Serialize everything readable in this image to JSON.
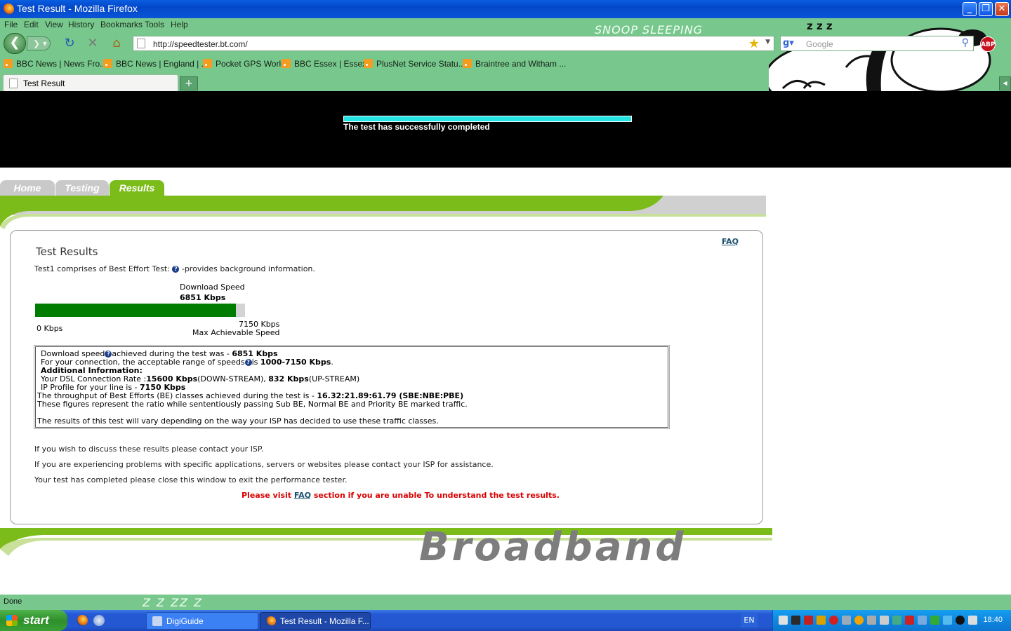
{
  "window": {
    "title": "Test Result - Mozilla Firefox",
    "minimize": "_",
    "restore": "❐",
    "close": "✕"
  },
  "menu": {
    "file": "File",
    "edit": "Edit",
    "view": "View",
    "history": "History",
    "bookmarks": "Bookmarks",
    "tools": "Tools",
    "help": "Help"
  },
  "theme_caption": "SNOOP SLEEPING",
  "nav": {
    "url": "http://speedtester.bt.com/",
    "search_placeholder": "Google",
    "adblock_label": "ABP"
  },
  "bookmarks_bar": [
    "BBC News | News Fro...",
    "BBC News | England | ...",
    "Pocket GPS World",
    "BBC Essex | Essex",
    "PlusNet Service Statu...",
    "Braintree and Witham ..."
  ],
  "tabs": {
    "active_label": "Test Result",
    "new_tab": "+"
  },
  "banner": {
    "progress": 1.0,
    "message": "The test has successfully completed"
  },
  "site_tabs": [
    {
      "label": "Home",
      "active": false
    },
    {
      "label": "Testing",
      "active": false
    },
    {
      "label": "Results",
      "active": true
    }
  ],
  "results": {
    "faq_link": "FAQ",
    "title": "Test Results",
    "intro_before": "Test1 comprises of Best Effort Test:",
    "intro_after": "-provides background information.",
    "download_label": "Download Speed",
    "download_value": "6851 Kbps",
    "download_kbps": 6851,
    "max_kbps": 7150,
    "min_label": "0 Kbps",
    "max_label": "7150 Kbps",
    "max_caption": "Max Achievable Speed"
  },
  "info": {
    "line1_a": "Download speed",
    "line1_b": "achieved during the test was - ",
    "line1_val": "6851 Kbps",
    "line2_a": "For your connection, the acceptable range of speeds",
    "line2_b": "is ",
    "line2_val": "1000-7150 Kbps",
    "line2_end": ".",
    "additional": "Additional Information:",
    "dsl_a": "Your DSL Connection Rate :",
    "dsl_down": "15600 Kbps",
    "dsl_down_lbl": "(DOWN-STREAM), ",
    "dsl_up": "832 Kbps",
    "dsl_up_lbl": "(UP-STREAM)",
    "ip_a": "IP Profile for your line is - ",
    "ip_val": "7150 Kbps",
    "thr_a": "The throughput of Best Efforts (BE) classes achieved during the test is - ",
    "thr_val": "16.32:21.89:61.79 (SBE:NBE:PBE)",
    "ratio": "These figures represent the ratio while sententiously passing Sub BE, Normal BE and Priority BE marked traffic.",
    "vary": "The results of this test will vary depending on the way your ISP has decided to use these traffic classes."
  },
  "footer_text": {
    "p1": "If you wish to discuss these results please contact your ISP.",
    "p2": "If you are experiencing problems with specific applications, servers or websites please contact your ISP for assistance.",
    "p3": "Your test has completed please close this window to exit the performance tester.",
    "visit_a": "Please visit ",
    "visit_link": "FAQ",
    "visit_b": " section if you are unable To understand the test results."
  },
  "brand": "Broadband",
  "status": {
    "text": "Done",
    "zz": "Z Z ZZ Z"
  },
  "taskbar": {
    "start": "start",
    "tasks": [
      "DigiGuide",
      "Test Result - Mozilla F..."
    ],
    "lang": "EN",
    "clock": "18:40"
  },
  "colors": {
    "chrome_green": "#78c88e",
    "bar_green": "#007c00",
    "accent_lime": "#7cbc1a",
    "progress_cyan": "#23e3e3",
    "alert_red": "#d90000"
  }
}
